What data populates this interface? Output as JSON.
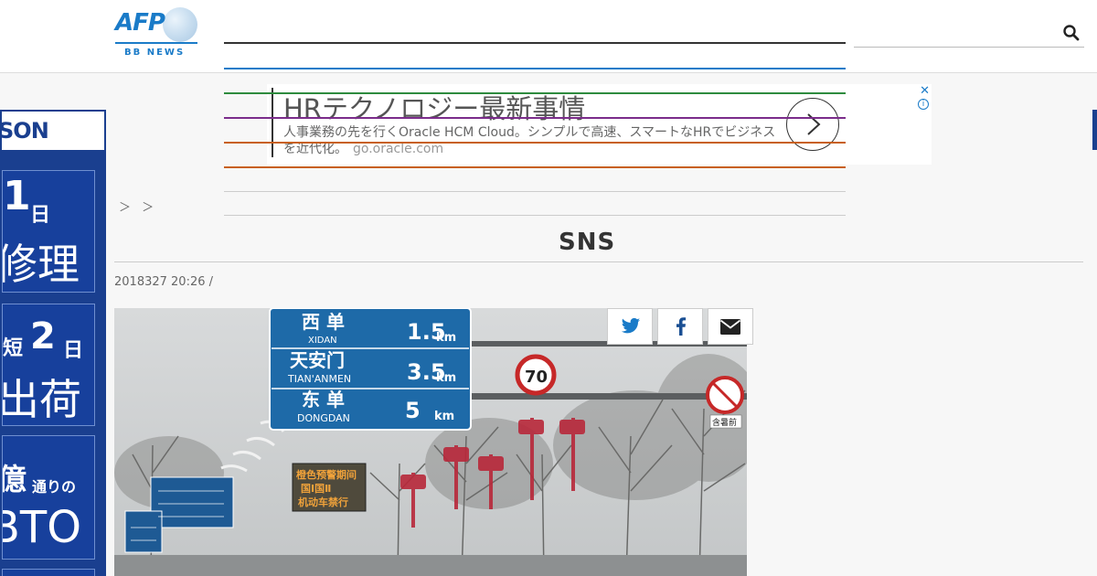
{
  "header": {
    "logo_main": "AFP",
    "logo_sub": "BB NEWS",
    "search_placeholder": ""
  },
  "top_ad": {
    "title": "HRテクノロジー最新事情",
    "description": "人事業務の先を行くOracle HCM Cloud。シンプルで高速、スマートなHRでビジネスを近代化。",
    "domain": "go.oracle.com",
    "close_icon": "close-icon",
    "info_icon": "adchoices-icon"
  },
  "side_ad": {
    "brand": "SON",
    "panel1_big": "1",
    "panel1_small": "日",
    "panel1_text": "修理",
    "panel2_small": "短",
    "panel2_big": "2",
    "panel2_small2": "日",
    "panel2_text": "出荷",
    "panel3_big": "億",
    "panel3_small": "通りの",
    "panel3_text": "BTO"
  },
  "article": {
    "breadcrumb": "＞ ＞",
    "title": "　　　　　　　　　　　　　　　　　　SNS　　　　",
    "date": "2018327 20:26  /"
  },
  "share": {
    "twitter_icon": "twitter-icon",
    "facebook_icon": "facebook-icon",
    "email_icon": "email-icon"
  },
  "photo": {
    "sign_rows": [
      {
        "cn": "西 单",
        "en": "XIDAN",
        "dist": "1.5",
        "unit": "km"
      },
      {
        "cn": "天安门",
        "en": "TIAN'ANMEN",
        "dist": "3.5",
        "unit": "km"
      },
      {
        "cn": "东 单",
        "en": "DONGDAN",
        "dist": "5",
        "unit": "km"
      }
    ],
    "speed_limit": "70",
    "warning_sign": [
      "橙色预警期间",
      "国Ⅰ国Ⅱ",
      "机动车禁行"
    ],
    "small_sign_label": "含暑前"
  },
  "colors": {
    "brand_blue": "#1a7bc8",
    "nav_lines": [
      "#333333",
      "#1a7bc8",
      "#2e8b3e",
      "#7b2c8b",
      "#c8601a",
      "#c8601a"
    ]
  }
}
